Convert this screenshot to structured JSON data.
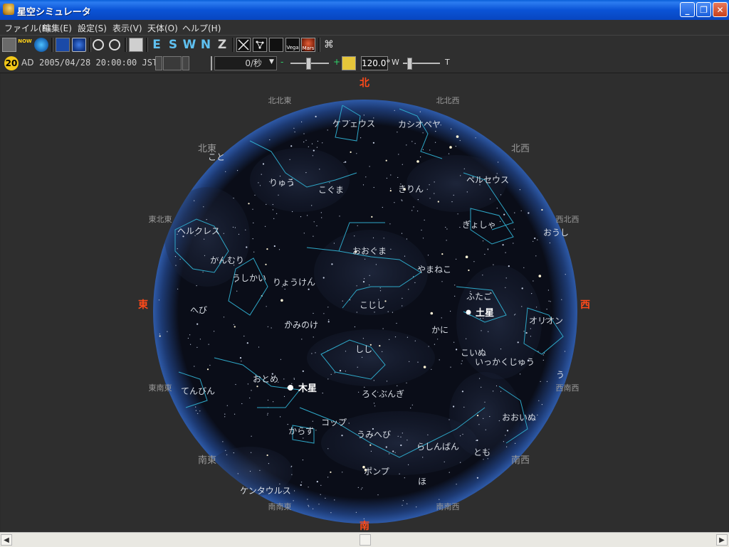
{
  "window": {
    "title": "星空シミュレータ",
    "minimize": "_",
    "maximize": "❐",
    "close": "✕"
  },
  "menu": [
    "ファイル(F)",
    "編集(E)",
    "設定(S)",
    "表示(V)",
    "天体(O)",
    "ヘルプ(H)"
  ],
  "toolbar": {
    "now_label": "NOW",
    "direction_buttons": [
      "E",
      "S",
      "W",
      "N",
      "Z"
    ],
    "vega_label": "Vega",
    "mars_label": "Mars",
    "binoculars_icon": "binoculars-icon"
  },
  "status": {
    "badge": "20",
    "era": "AD",
    "datetime": "2005/04/28 20:00:00 JST",
    "speed": "0/秒",
    "minus": "-",
    "plus": "+",
    "fov": "120.0°",
    "wide": "W",
    "tele": "T"
  },
  "sky": {
    "cardinal": {
      "north": "北",
      "south": "南",
      "east": "東",
      "west": "西"
    },
    "directions": {
      "nne": "北北東",
      "nnw": "北北西",
      "ne": "北東",
      "nw": "北西",
      "ene": "東北東",
      "wnw": "西北西",
      "ese": "東南東",
      "wsw": "西南西",
      "se": "南東",
      "sw": "南西",
      "sse": "南南東",
      "ssw": "南南西"
    },
    "constellations": {
      "cepheus": "ケフェウス",
      "cassiopeia": "カシオペヤ",
      "draco": "りゅう",
      "ursa_minor": "こぐま",
      "camelopardalis": "きりん",
      "perseus": "ペルセウス",
      "auriga": "ぎょしゃ",
      "auriga2": "おうし",
      "hercules": "ヘルクレス",
      "ursa_major": "おおぐま",
      "corona": "かんむり",
      "bootes": "うしかい",
      "canes": "りょうけん",
      "lynx": "やまねこ",
      "gemini": "ふたご",
      "serpens": "へび",
      "leo_minor": "こじし",
      "coma": "かみのけ",
      "orion": "オリオン",
      "cancer": "かに",
      "leo": "しし",
      "canis_minor": "こいぬ",
      "monoceros": "いっかくじゅう",
      "virgo": "おとめ",
      "libra": "てんびん",
      "sextans": "ろくぶんぎ",
      "corvus": "からす",
      "crater": "コップ",
      "hydra": "うみへび",
      "pyxis": "らしんばん",
      "canis_major": "おおいぬ",
      "puppis": "とも",
      "antlia": "ポンプ",
      "centaurus": "ケンタウルス",
      "vela": "ほ",
      "taurus_partial": "う",
      "lepus_partial": "こと"
    },
    "planets": {
      "saturn": "土星",
      "jupiter": "木星"
    }
  },
  "colors": {
    "cardinal": "#ff4a1a",
    "constellation_line": "#2ea8c8",
    "constellation_text": "#d8dde4",
    "direction_text": "#9a9a9a"
  }
}
